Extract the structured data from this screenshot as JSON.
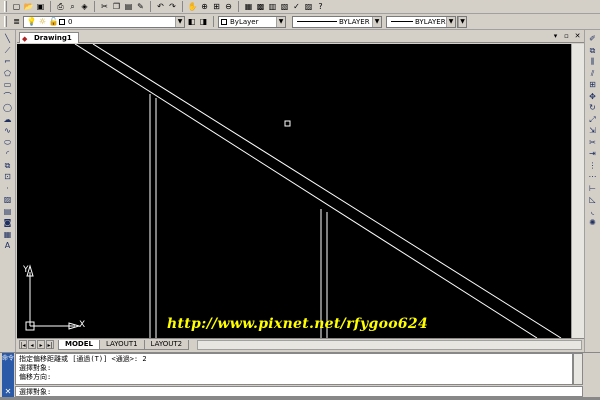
{
  "toolbar": {
    "layer_value": "0",
    "color_value": "ByLayer",
    "linetype_value": "BYLAYER",
    "lineweight_value": "BYLAYER"
  },
  "drawing": {
    "tab_title": "Drawing1",
    "ucs_x": "X",
    "ucs_y": "Y",
    "watermark": "http://www.pixnet.net/rfygoo624"
  },
  "layout_tabs": {
    "model": "MODEL",
    "layout1": "LAYOUT1",
    "layout2": "LAYOUT2"
  },
  "command": {
    "history": [
      "指定偏移距離或 [通過(T)] <通過>:  2",
      "選擇對象:",
      "偏移方向:"
    ],
    "prompt": "選擇對象:",
    "panel_label": "命令"
  },
  "colors": {
    "canvas_bg": "#000000",
    "watermark": "#ffff00",
    "lines": "#ffffff"
  }
}
